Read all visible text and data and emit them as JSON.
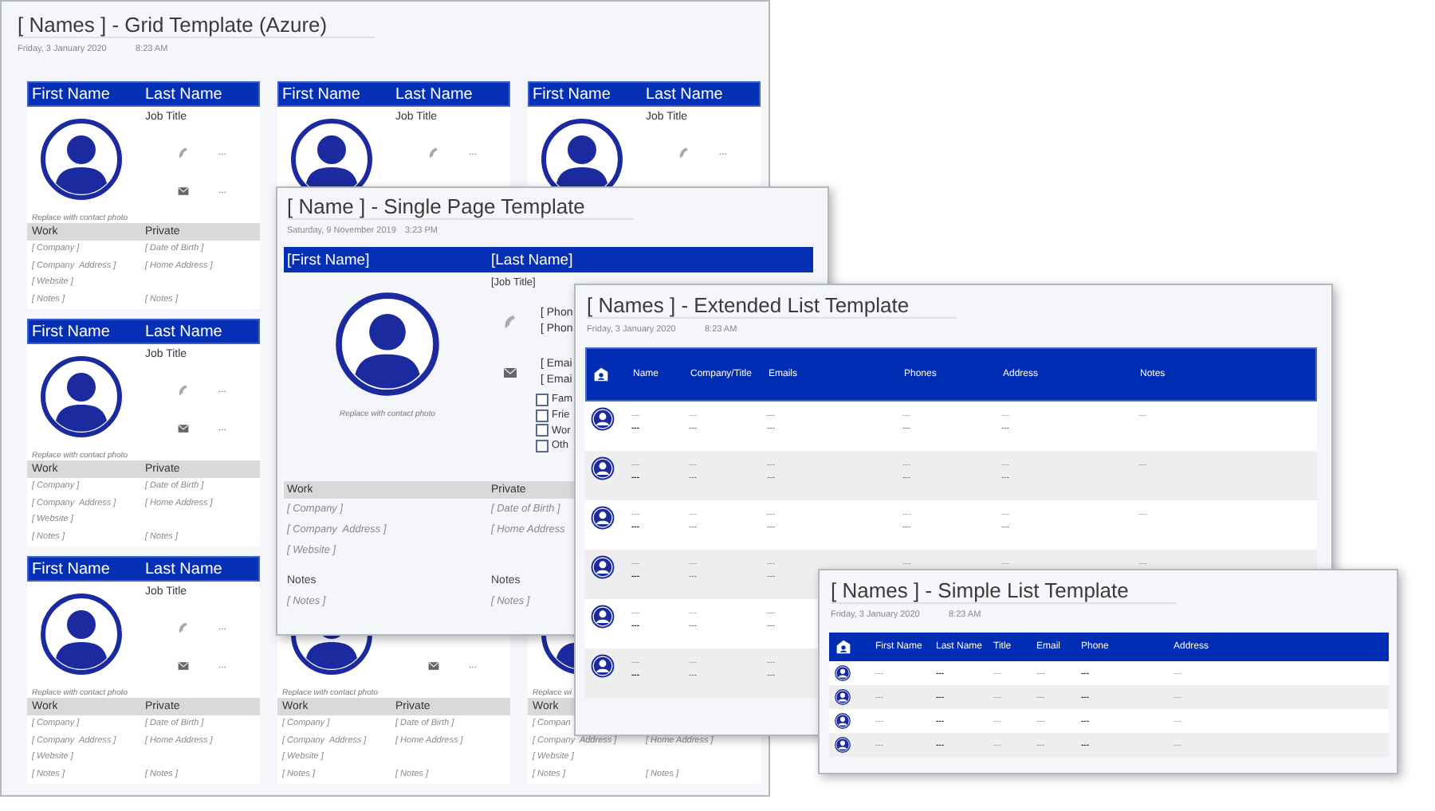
{
  "grid_window": {
    "title": "[ Names ] - Grid Template (Azure)",
    "date": "Friday, 3 January 2020",
    "time": "8:23 AM",
    "cards": [
      [
        {
          "first": "First Name",
          "last": "Last Name",
          "job": "Job Title",
          "phone": "...",
          "email": "...",
          "caption": "Replace with contact photo",
          "work_label": "Work",
          "private_label": "Private",
          "fields": [
            {
              "left": "[ Company ]",
              "right": "[ Date of Birth ]"
            },
            {
              "left": "[ Company  Address ]",
              "right": "[ Home Address ]"
            },
            {
              "left": "[ Website ]"
            },
            {
              "left": "[ Notes ]",
              "right": "[ Notes ]"
            }
          ]
        },
        {
          "first": "First Name",
          "last": "Last Name",
          "job": "Job Title",
          "phone": "..."
        },
        {
          "first": "First Name",
          "last": "Last Name",
          "job": "Job Title",
          "phone": "..."
        }
      ],
      [
        {
          "first": "First Name",
          "last": "Last Name",
          "job": "Job Title",
          "phone": "...",
          "email": "...",
          "caption": "Replace with contact photo",
          "work_label": "Work",
          "private_label": "Private",
          "fields": [
            {
              "left": "[ Company ]",
              "right": "[ Date of Birth ]"
            },
            {
              "left": "[ Company  Address ]",
              "right": "[ Home Address ]"
            },
            {
              "left": "[ Website ]"
            },
            {
              "left": "[ Notes ]",
              "right": "[ Notes ]"
            }
          ]
        }
      ],
      [
        {
          "first": "First Name",
          "last": "Last Name",
          "job": "Job Title",
          "phone": "...",
          "email": "...",
          "caption": "Replace with contact photo",
          "work_label": "Work",
          "private_label": "Private",
          "fields": [
            {
              "left": "[ Company ]",
              "right": "[ Date of Birth ]"
            },
            {
              "left": "[ Company  Address ]",
              "right": "[ Home Address ]"
            },
            {
              "left": "[ Website ]"
            },
            {
              "left": "[ Notes ]",
              "right": "[ Notes ]"
            }
          ]
        },
        {
          "email": "...",
          "caption": "Replace with contact photo",
          "work_label": "Work",
          "private_label": "Private",
          "fields": [
            {
              "left": "[ Company ]",
              "right": "[ Date of Birth ]"
            },
            {
              "left": "[ Company  Address ]",
              "right": "[ Home Address ]"
            },
            {
              "left": "[ Website ]"
            },
            {
              "left": "[ Notes ]",
              "right": "[ Notes ]"
            }
          ]
        },
        {
          "caption": "Replace wi",
          "work_label": "Work",
          "fields": [
            {
              "left": "[ Compan"
            },
            {
              "left": "[ Company  Address ]",
              "right": "[ Home Address ]"
            },
            {
              "left": "[ Website ]"
            },
            {
              "left": "[ Notes ]",
              "right": "[ Notes ]"
            }
          ]
        }
      ]
    ]
  },
  "single_page_window": {
    "title": "[ Name ] - Single Page Template",
    "date": "Saturday, 9 November 2019",
    "time": "3:23 PM",
    "first": "[First Name]",
    "last": "[Last Name]",
    "job": "[Job Title]",
    "caption": "Replace with contact photo",
    "phones": [
      "[ Phon",
      "[ Phon"
    ],
    "emails": [
      "[ Emai",
      "[ Emai"
    ],
    "checkboxes": [
      {
        "label": "Fam",
        "checked": false
      },
      {
        "label": "Frie",
        "checked": false
      },
      {
        "label": "Wor",
        "checked": false
      },
      {
        "label": "Oth",
        "checked": false
      }
    ],
    "work_label": "Work",
    "private_label": "Private",
    "fields": [
      {
        "left": "[ Company ]",
        "right": "[ Date of Birth ]"
      },
      {
        "left": "[ Company  Address ]",
        "right": "[ Home Address"
      },
      {
        "left": "[ Website ]"
      }
    ],
    "notes_labels": [
      "Notes",
      "Notes"
    ],
    "notes": [
      "[ Notes ]",
      "[ Notes ]"
    ]
  },
  "extended_list_window": {
    "title": "[ Names ] - Extended List Template",
    "date": "Friday, 3 January 2020",
    "time": "8:23 AM",
    "columns": [
      "Name",
      "Company/Title",
      "Emails",
      "Phones",
      "Address",
      "Notes"
    ],
    "rows": [
      {
        "cells": [
          [
            "---",
            "---"
          ],
          [
            "---",
            "---"
          ],
          [
            "---",
            "---"
          ],
          [
            "---",
            "---"
          ],
          [
            "---",
            "---"
          ],
          [
            "---"
          ]
        ]
      },
      {
        "cells": [
          [
            "---",
            "---"
          ],
          [
            "---",
            "---"
          ],
          [
            "---",
            "---"
          ],
          [
            "---",
            "---"
          ],
          [
            "---",
            "---"
          ],
          [
            "---"
          ]
        ]
      },
      {
        "cells": [
          [
            "---",
            "---"
          ],
          [
            "---",
            "---"
          ],
          [
            "---",
            "---"
          ],
          [
            "---",
            "---"
          ],
          [
            "---",
            "---"
          ],
          [
            "---"
          ]
        ]
      },
      {
        "cells": [
          [
            "---",
            "---"
          ],
          [
            "---",
            "---"
          ],
          [
            "---",
            "---"
          ],
          [
            "---"
          ],
          [
            "---"
          ],
          [
            "---"
          ]
        ]
      },
      {
        "cells": [
          [
            "---",
            "---"
          ],
          [
            "---",
            "---"
          ],
          [
            "---",
            "---"
          ]
        ]
      },
      {
        "cells": [
          [
            "---",
            "---"
          ],
          [
            "---",
            "---"
          ],
          [
            "---",
            "---"
          ]
        ]
      }
    ]
  },
  "simple_list_window": {
    "title": "[ Names ] - Simple List Template",
    "date": "Friday, 3 January 2020",
    "time": "8:23 AM",
    "columns": [
      "First Name",
      "Last Name",
      "Title",
      "Email",
      "Phone",
      "Address"
    ],
    "rows": [
      {
        "cells": [
          "---",
          "---",
          "---",
          "---",
          "---",
          "---"
        ]
      },
      {
        "cells": [
          "---",
          "---",
          "---",
          "---",
          "---",
          "---"
        ]
      },
      {
        "cells": [
          "---",
          "---",
          "---",
          "---",
          "---",
          "---"
        ]
      },
      {
        "cells": [
          "---",
          "---",
          "---",
          "---",
          "---",
          "---"
        ]
      }
    ]
  }
}
